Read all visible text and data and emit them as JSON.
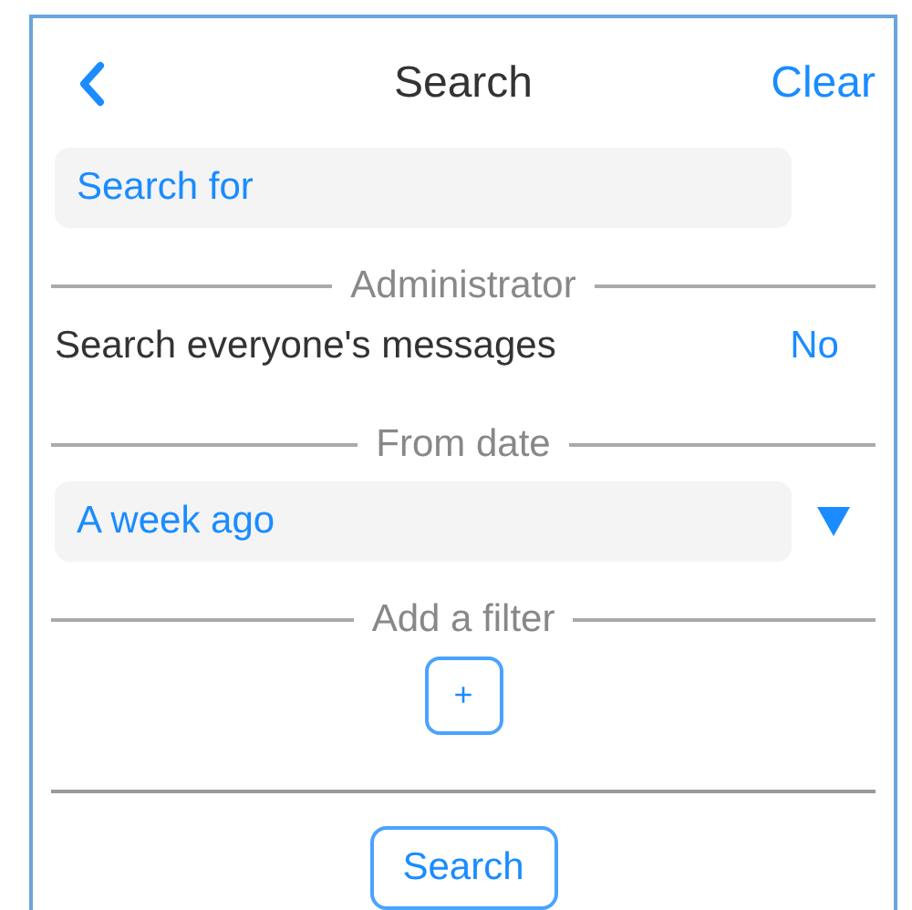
{
  "header": {
    "title": "Search",
    "action": "Clear"
  },
  "search": {
    "placeholder": "Search for"
  },
  "sections": [
    {
      "kind": "toggle",
      "heading": "Administrator",
      "label": "Search everyone's messages",
      "value": "No"
    },
    {
      "kind": "dropdown",
      "heading": "From date",
      "value": "A week ago"
    },
    {
      "kind": "add",
      "heading": "Add a filter",
      "button": "+"
    }
  ],
  "submit": "Search"
}
